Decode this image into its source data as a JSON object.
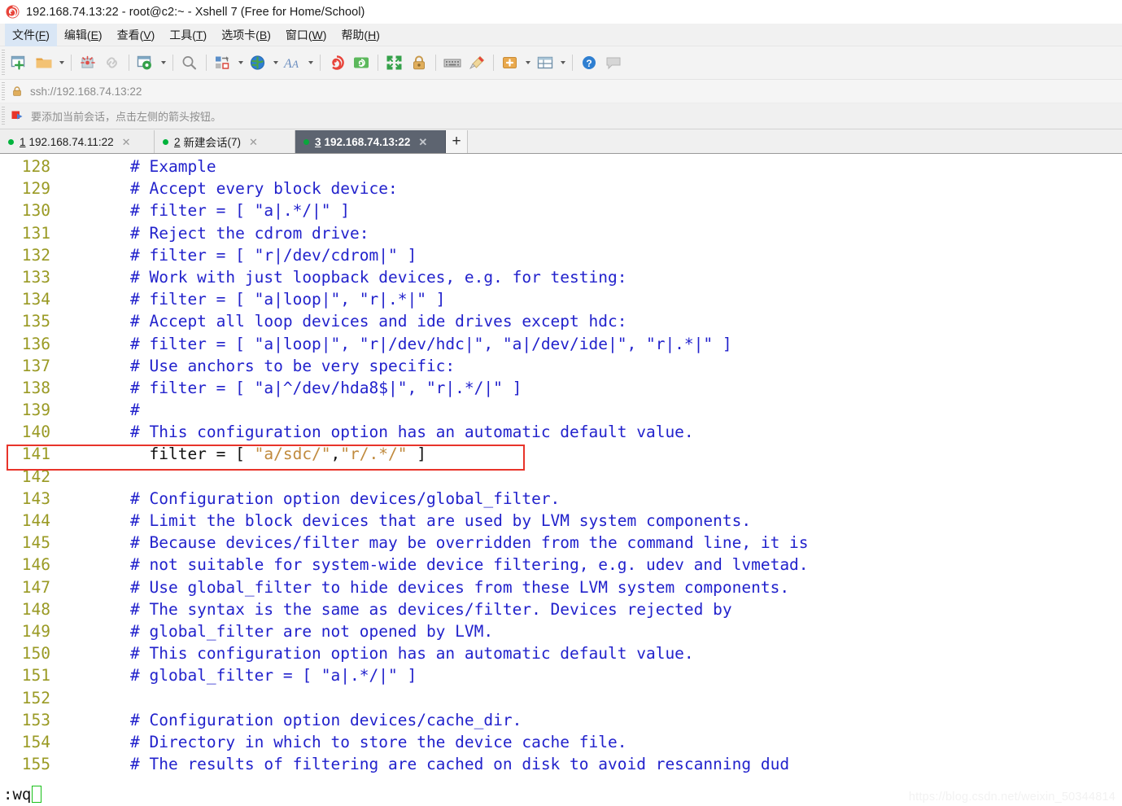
{
  "window": {
    "title": "192.168.74.13:22 - root@c2:~ - Xshell 7 (Free for Home/School)",
    "app_icon": "xshell-logo-icon"
  },
  "menubar": {
    "items": [
      {
        "label": "文件(F)",
        "pre": "文件(",
        "key": "F",
        "post": ")",
        "active": true
      },
      {
        "label": "编辑(E)",
        "pre": "编辑(",
        "key": "E",
        "post": ")",
        "active": false
      },
      {
        "label": "查看(V)",
        "pre": "查看(",
        "key": "V",
        "post": ")",
        "active": false
      },
      {
        "label": "工具(T)",
        "pre": "工具(",
        "key": "T",
        "post": ")",
        "active": false
      },
      {
        "label": "选项卡(B)",
        "pre": "选项卡(",
        "key": "B",
        "post": ")",
        "active": false
      },
      {
        "label": "窗口(W)",
        "pre": "窗口(",
        "key": "W",
        "post": ")",
        "active": false
      },
      {
        "label": "帮助(H)",
        "pre": "帮助(",
        "key": "H",
        "post": ")",
        "active": false
      }
    ]
  },
  "toolbar": {
    "buttons": [
      {
        "name": "new-session-icon"
      },
      {
        "name": "open-folder-icon"
      },
      {
        "name": "open-folder-dropdown-caret-icon"
      },
      {
        "name": "separator"
      },
      {
        "name": "disconnect-icon"
      },
      {
        "name": "reconnect-link-icon"
      },
      {
        "name": "separator"
      },
      {
        "name": "session-properties-icon"
      },
      {
        "name": "session-properties-dropdown-caret-icon"
      },
      {
        "name": "separator"
      },
      {
        "name": "find-icon"
      },
      {
        "name": "separator"
      },
      {
        "name": "transfer-file-icon"
      },
      {
        "name": "transfer-file-dropdown-caret-icon"
      },
      {
        "name": "globe-icon"
      },
      {
        "name": "globe-dropdown-caret-icon"
      },
      {
        "name": "font-size-icon"
      },
      {
        "name": "font-size-dropdown-caret-icon"
      },
      {
        "name": "separator"
      },
      {
        "name": "xftp-icon"
      },
      {
        "name": "xshell-green-icon"
      },
      {
        "name": "separator"
      },
      {
        "name": "fullscreen-icon"
      },
      {
        "name": "lock-icon"
      },
      {
        "name": "separator"
      },
      {
        "name": "keyboard-icon"
      },
      {
        "name": "highlight-pen-icon"
      },
      {
        "name": "separator"
      },
      {
        "name": "compose-bar-icon"
      },
      {
        "name": "compose-bar-dropdown-caret-icon"
      },
      {
        "name": "layout-icon"
      },
      {
        "name": "layout-dropdown-caret-icon"
      },
      {
        "name": "separator"
      },
      {
        "name": "help-icon"
      },
      {
        "name": "chat-icon"
      }
    ]
  },
  "addressbar": {
    "lock_icon": "lock-icon",
    "value": "ssh://192.168.74.13:22"
  },
  "notice": {
    "icon": "red-arrow-flag-icon",
    "text": "要添加当前会话，点击左侧的箭头按钮。"
  },
  "tabs": {
    "items": [
      {
        "num": "1",
        "label": "192.168.74.11:22",
        "suffix": "",
        "active": false
      },
      {
        "num": "2",
        "label": "新建会话",
        "suffix": " (7)",
        "active": false
      },
      {
        "num": "3",
        "label": "192.168.74.13:22",
        "suffix": "",
        "active": true
      }
    ],
    "add_label": "+",
    "close_glyph": "✕"
  },
  "terminal": {
    "lines": [
      {
        "num": "128",
        "segments": [
          {
            "t": "comment",
            "s": "# Example"
          }
        ]
      },
      {
        "num": "129",
        "segments": [
          {
            "t": "comment",
            "s": "# Accept every block device:"
          }
        ]
      },
      {
        "num": "130",
        "segments": [
          {
            "t": "comment",
            "s": "# filter = [ \"a|.*/|\" ]"
          }
        ]
      },
      {
        "num": "131",
        "segments": [
          {
            "t": "comment",
            "s": "# Reject the cdrom drive:"
          }
        ]
      },
      {
        "num": "132",
        "segments": [
          {
            "t": "comment",
            "s": "# filter = [ \"r|/dev/cdrom|\" ]"
          }
        ]
      },
      {
        "num": "133",
        "segments": [
          {
            "t": "comment",
            "s": "# Work with just loopback devices, e.g. for testing:"
          }
        ]
      },
      {
        "num": "134",
        "segments": [
          {
            "t": "comment",
            "s": "# filter = [ \"a|loop|\", \"r|.*|\" ]"
          }
        ]
      },
      {
        "num": "135",
        "segments": [
          {
            "t": "comment",
            "s": "# Accept all loop devices and ide drives except hdc:"
          }
        ]
      },
      {
        "num": "136",
        "segments": [
          {
            "t": "comment",
            "s": "# filter = [ \"a|loop|\", \"r|/dev/hdc|\", \"a|/dev/ide|\", \"r|.*|\" ]"
          }
        ]
      },
      {
        "num": "137",
        "segments": [
          {
            "t": "comment",
            "s": "# Use anchors to be very specific:"
          }
        ]
      },
      {
        "num": "138",
        "segments": [
          {
            "t": "comment",
            "s": "# filter = [ \"a|^/dev/hda8$|\", \"r|.*/|\" ]"
          }
        ]
      },
      {
        "num": "139",
        "segments": [
          {
            "t": "comment",
            "s": "#"
          }
        ]
      },
      {
        "num": "140",
        "segments": [
          {
            "t": "comment",
            "s": "# This configuration option has an automatic default value."
          }
        ]
      },
      {
        "num": "141",
        "highlighted": true,
        "segments": [
          {
            "t": "plain",
            "s": "  filter = [ "
          },
          {
            "t": "string",
            "s": "\"a/sdc/\""
          },
          {
            "t": "plain",
            "s": ","
          },
          {
            "t": "string",
            "s": "\"r/.*/\""
          },
          {
            "t": "plain",
            "s": " ]"
          }
        ]
      },
      {
        "num": "142",
        "segments": [
          {
            "t": "plain",
            "s": ""
          }
        ]
      },
      {
        "num": "143",
        "segments": [
          {
            "t": "comment",
            "s": "# Configuration option devices/global_filter."
          }
        ]
      },
      {
        "num": "144",
        "segments": [
          {
            "t": "comment",
            "s": "# Limit the block devices that are used by LVM system components."
          }
        ]
      },
      {
        "num": "145",
        "segments": [
          {
            "t": "comment",
            "s": "# Because devices/filter may be overridden from the command line, it is"
          }
        ]
      },
      {
        "num": "146",
        "segments": [
          {
            "t": "comment",
            "s": "# not suitable for system-wide device filtering, e.g. udev and lvmetad."
          }
        ]
      },
      {
        "num": "147",
        "segments": [
          {
            "t": "comment",
            "s": "# Use global_filter to hide devices from these LVM system components."
          }
        ]
      },
      {
        "num": "148",
        "segments": [
          {
            "t": "comment",
            "s": "# The syntax is the same as devices/filter. Devices rejected by"
          }
        ]
      },
      {
        "num": "149",
        "segments": [
          {
            "t": "comment",
            "s": "# global_filter are not opened by LVM."
          }
        ]
      },
      {
        "num": "150",
        "segments": [
          {
            "t": "comment",
            "s": "# This configuration option has an automatic default value."
          }
        ]
      },
      {
        "num": "151",
        "segments": [
          {
            "t": "comment",
            "s": "# global_filter = [ \"a|.*/|\" ]"
          }
        ]
      },
      {
        "num": "152",
        "segments": [
          {
            "t": "plain",
            "s": ""
          }
        ]
      },
      {
        "num": "153",
        "segments": [
          {
            "t": "comment",
            "s": "# Configuration option devices/cache_dir."
          }
        ]
      },
      {
        "num": "154",
        "segments": [
          {
            "t": "comment",
            "s": "# Directory in which to store the device cache file."
          }
        ]
      },
      {
        "num": "155",
        "segments": [
          {
            "t": "comment",
            "s": "# The results of filtering are cached on disk to avoid rescanning dud"
          }
        ]
      }
    ]
  },
  "statusbar": {
    "command": ":wq",
    "watermark": "https://blog.csdn.net/weixin_50344814"
  },
  "colors": {
    "line_number": "#9a9a24",
    "comment": "#2222cc",
    "string": "#c08a3e",
    "plain": "#111111",
    "annotation_red": "#e8342a",
    "active_tab_bg": "#5d6470",
    "cursor_green": "#18c018"
  }
}
